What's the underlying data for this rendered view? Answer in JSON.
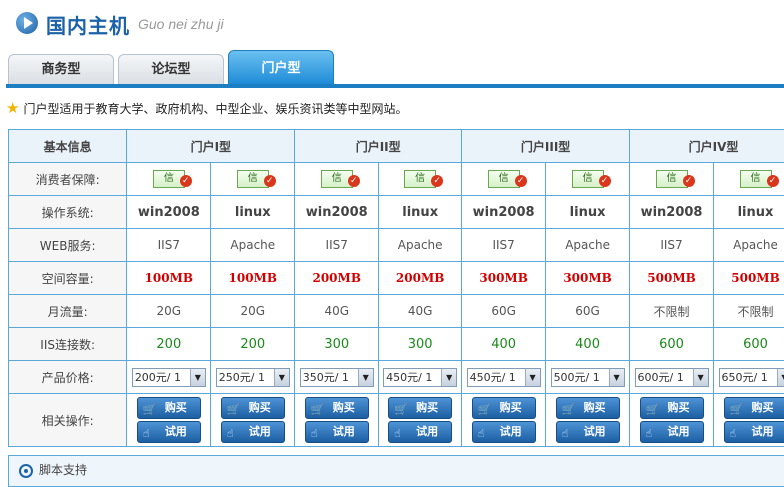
{
  "header": {
    "title": "国内主机",
    "subtitle": "Guo nei zhu ji"
  },
  "tabs": [
    {
      "label": "商务型",
      "active": false
    },
    {
      "label": "论坛型",
      "active": false
    },
    {
      "label": "门户型",
      "active": true
    }
  ],
  "intro": "门户型适用于教育大学、政府机构、中型企业、娱乐资讯类等中型网站。",
  "table": {
    "corner": "基本信息",
    "plans": [
      "门户I型",
      "门户II型",
      "门户III型",
      "门户IV型"
    ],
    "rows": {
      "guarantee": {
        "label": "消费者保障:",
        "badge": "信"
      },
      "os": {
        "label": "操作系统:",
        "values": [
          "win2008",
          "linux",
          "win2008",
          "linux",
          "win2008",
          "linux",
          "win2008",
          "linux"
        ]
      },
      "web": {
        "label": "WEB服务:",
        "values": [
          "IIS7",
          "Apache",
          "IIS7",
          "Apache",
          "IIS7",
          "Apache",
          "IIS7",
          "Apache"
        ]
      },
      "space": {
        "label": "空间容量:",
        "values": [
          "100MB",
          "100MB",
          "200MB",
          "200MB",
          "300MB",
          "300MB",
          "500MB",
          "500MB"
        ]
      },
      "flow": {
        "label": "月流量:",
        "values": [
          "20G",
          "20G",
          "40G",
          "40G",
          "60G",
          "60G",
          "不限制",
          "不限制"
        ]
      },
      "iis": {
        "label": "IIS连接数:",
        "values": [
          "200",
          "200",
          "300",
          "300",
          "400",
          "400",
          "600",
          "600"
        ]
      },
      "price": {
        "label": "产品价格:",
        "values": [
          "200元/ 1",
          "250元/ 1",
          "350元/ 1",
          "450元/ 1",
          "450元/ 1",
          "500元/ 1",
          "600元/ 1",
          "650元/ 1"
        ]
      },
      "ops": {
        "label": "相关操作:",
        "buy": "购买",
        "trial": "试用"
      }
    }
  },
  "footer": {
    "label": "脚本支持"
  },
  "colors": {
    "accent": "#1c7fc4",
    "border": "#5aa9dd",
    "space_red": "#d40000",
    "iis_green": "#1a8a1a"
  }
}
